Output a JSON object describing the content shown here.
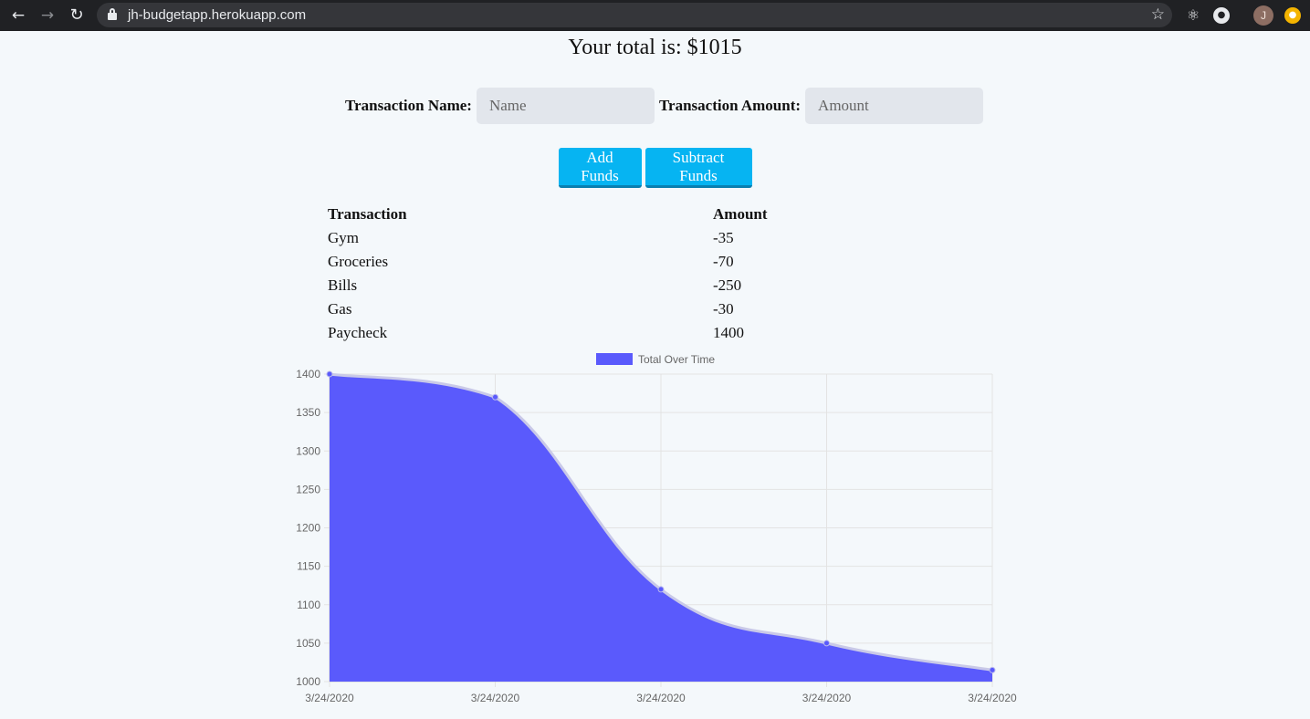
{
  "browser": {
    "url": "jh-budgetapp.herokuapp.com",
    "avatar_letter": "J",
    "icons": [
      "back-arrow-icon",
      "forward-arrow-icon",
      "reload-icon",
      "lock-icon",
      "bookmark-star-icon",
      "react-devtools-icon",
      "extension-icon",
      "profile-avatar",
      "extension-icon"
    ]
  },
  "page": {
    "total_text": "Your total is: $1015",
    "name_label": "Transaction Name:",
    "name_placeholder": "Name",
    "amount_label": "Transaction Amount:",
    "amount_placeholder": "Amount",
    "add_button": "Add Funds",
    "subtract_button": "Subtract Funds"
  },
  "table": {
    "headers": [
      "Transaction",
      "Amount"
    ],
    "rows": [
      [
        "Gym",
        "-35"
      ],
      [
        "Groceries",
        "-70"
      ],
      [
        "Bills",
        "-250"
      ],
      [
        "Gas",
        "-30"
      ],
      [
        "Paycheck",
        "1400"
      ]
    ]
  },
  "colors": {
    "accent_button": "#06b4f2",
    "series_fill": "#5a5afc",
    "series_stroke": "#5a5afc"
  },
  "chart_data": {
    "type": "area",
    "title": "",
    "xlabel": "",
    "ylabel": "",
    "legend_position": "top",
    "grid": true,
    "categories": [
      "3/24/2020",
      "3/24/2020",
      "3/24/2020",
      "3/24/2020",
      "3/24/2020"
    ],
    "ylim": [
      1000,
      1400
    ],
    "yticks": [
      1000,
      1050,
      1100,
      1150,
      1200,
      1250,
      1300,
      1350,
      1400
    ],
    "series": [
      {
        "name": "Total Over Time",
        "values": [
          1400,
          1370,
          1120,
          1050,
          1015
        ]
      }
    ]
  }
}
